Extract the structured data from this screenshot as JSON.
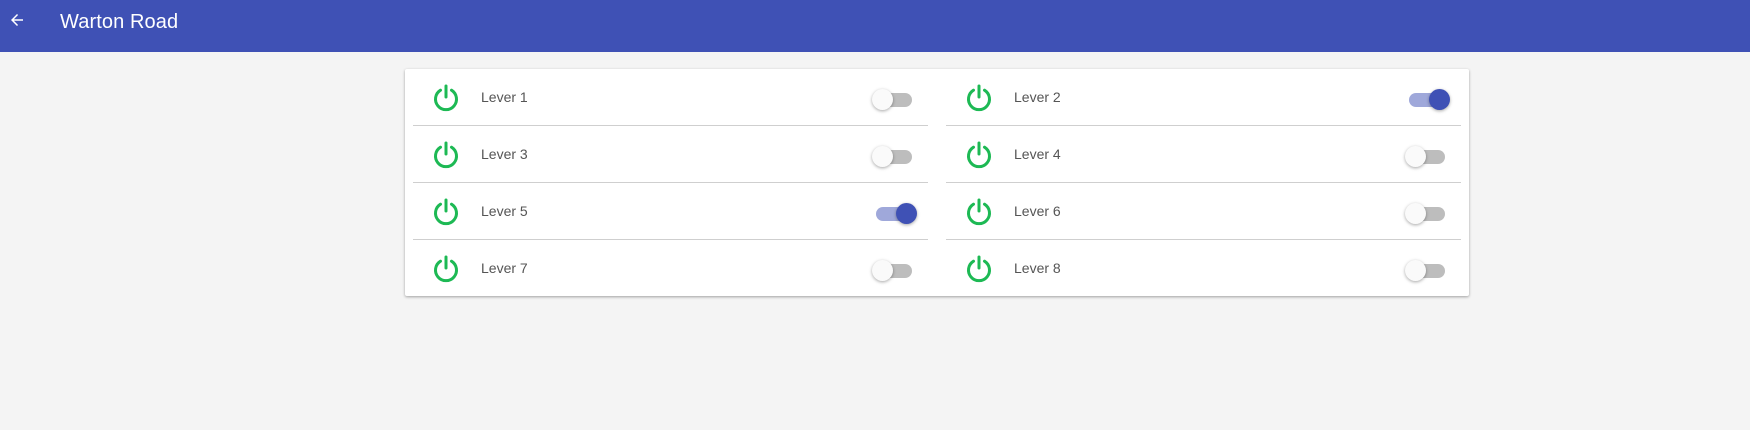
{
  "header": {
    "title": "Warton Road",
    "back_icon": "arrow-back-icon"
  },
  "colors": {
    "appbar": "#3f51b5",
    "power_icon": "#1db954",
    "switch_on_thumb": "#3f51b5",
    "switch_on_track": "#9fa8da",
    "switch_off_track": "#bdbdbd"
  },
  "levers": [
    {
      "label": "Lever 1",
      "on": false,
      "icon": "power-icon"
    },
    {
      "label": "Lever 2",
      "on": true,
      "icon": "power-icon"
    },
    {
      "label": "Lever 3",
      "on": false,
      "icon": "power-icon"
    },
    {
      "label": "Lever 4",
      "on": false,
      "icon": "power-icon"
    },
    {
      "label": "Lever 5",
      "on": true,
      "icon": "power-icon"
    },
    {
      "label": "Lever 6",
      "on": false,
      "icon": "power-icon"
    },
    {
      "label": "Lever 7",
      "on": false,
      "icon": "power-icon"
    },
    {
      "label": "Lever 8",
      "on": false,
      "icon": "power-icon"
    }
  ]
}
